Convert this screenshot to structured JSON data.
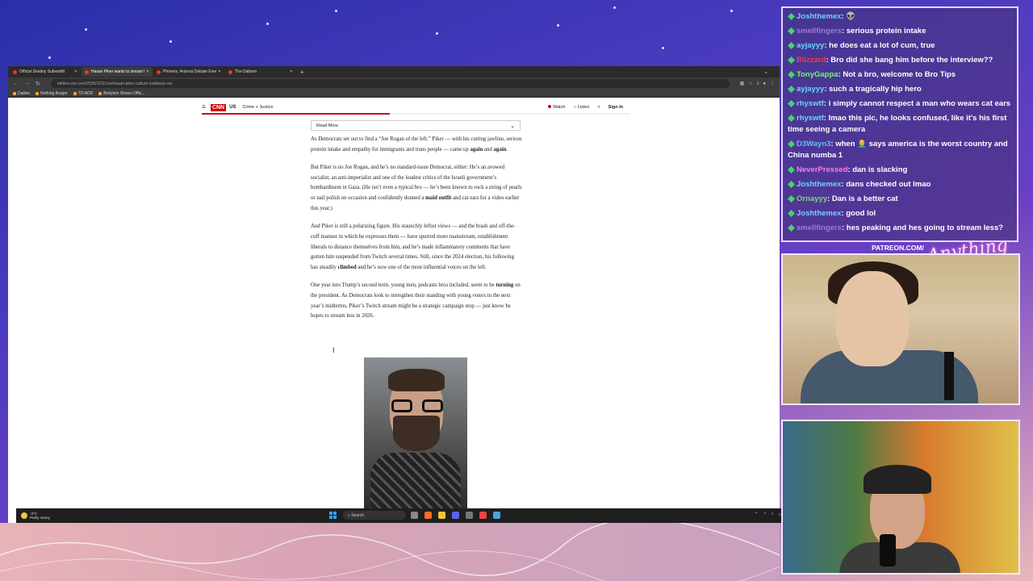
{
  "browser": {
    "tabs": [
      {
        "label": "Official Destiny Subreddit",
        "active": false
      },
      {
        "label": "Hasan Piker wants to stream le...",
        "active": true
      },
      {
        "label": "Phoenix, Arizona Debate Event",
        "active": false
      },
      {
        "label": "The Dablam",
        "active": false
      }
    ],
    "url": "edition.cnn.com/2025/12/21/us/hasan-piker-culture-lookback-cec",
    "bookmarks": [
      "Dailies",
      "Nothing Burger",
      "TO ADD",
      "Bodyism Shows Offic..."
    ]
  },
  "cnn": {
    "logo": "CNN",
    "edition": "US",
    "section": "Crime + Justice",
    "watch": "Watch",
    "listen": "Listen",
    "sign_in": "Sign In",
    "read_more": "Read More",
    "reading_progress": 0.44
  },
  "article": {
    "p1_a": "As Democrats set out to find a “Joe Rogan of the left,” Piker — with his cutting jawline, serious protein intake and empathy for immigrants and trans people — came up ",
    "p1_b1": "again",
    "p1_mid": " and ",
    "p1_b2": "again",
    "p1_end": ".",
    "p2_a": "But Piker is no Joe Rogan, and he’s no standard-issue Democrat, either: He’s an avowed socialist, an anti-imperialist and one of the loudest critics of the Israeli government’s bombardment in Gaza. (He isn’t even a typical bro — he’s been known to rock a string of pearls or nail polish on occasion and confidently donned a ",
    "p2_b": "maid outfit",
    "p2_end": " and cat ears for a video earlier this year.)",
    "p3_a": "And Piker is still a polarizing figure. His staunchly leftist views — and the brash and off-the-cuff manner in which he expresses them — have spurred more mainstream, establishment liberals to distance themselves from him, and he’s made inflammatory comments that have gotten him suspended from Twitch several times. Still, since the 2024 election, his following has steadily ",
    "p3_b": "climbed",
    "p3_end": " and he’s now one of the most influential voices on the left.",
    "p4_a": "One year into Trump’s second term, young men, podcasts bros included, seem to be ",
    "p4_b": "turning",
    "p4_end": " on the president. As Democrats look to strengthen their standing with young voters in the next year’s midterms, Piker’s Twitch stream might be a strategic campaign stop — just know he hopes to stream less in 2026."
  },
  "taskbar": {
    "temp": "-3°C",
    "weather": "Partly sunny",
    "search": "Search"
  },
  "chat": [
    {
      "user": "Joshthemex",
      "color": "#6fd1ff",
      "text": "👽"
    },
    {
      "user": "smellfingers",
      "color": "#9a7bd9",
      "text": "serious protein intake"
    },
    {
      "user": "ayjayyy",
      "color": "#66d9ff",
      "text": "he does eat a lot of cum, true"
    },
    {
      "user": "Blizzard",
      "color": "#ff3b3b",
      "text": "Bro did she bang him before the interview??"
    },
    {
      "user": "TonyGappa",
      "color": "#6bff6b",
      "text": "Not a bro, welcome to Bro Tips"
    },
    {
      "user": "ayjayyy",
      "color": "#66d9ff",
      "text": "such a tragically hip hero"
    },
    {
      "user": "rhyswtf",
      "color": "#6fd1ff",
      "text": "i simply cannot respect a man who wears cat ears"
    },
    {
      "user": "rhyswtf",
      "color": "#6fd1ff",
      "text": "lmao this pic, he looks confused, like it's his first time seeing a camera"
    },
    {
      "user": "D3Wayn3",
      "color": "#5ec0ff",
      "text": "when 👨‍🦲 says america is the worst country and China numba 1"
    },
    {
      "user": "NeverPressed",
      "color": "#ff7ee0",
      "text": "dan is slacking"
    },
    {
      "user": "Joshthemex",
      "color": "#6fd1ff",
      "text": "dans checked out lmao"
    },
    {
      "user": "Ornayyy",
      "color": "#7bd96b",
      "text": "Dan is a better cat"
    },
    {
      "user": "Joshthemex",
      "color": "#6fd1ff",
      "text": "good lol"
    },
    {
      "user": "smellfingers",
      "color": "#9a7bd9",
      "text": "hes peaking and hes going to stream less?"
    }
  ],
  "overlay": {
    "patreon": "PATREON.COM/",
    "sign": "Anything Goes"
  },
  "colors": {
    "cnn_red": "#cc0000",
    "chat_border": "#e8d3ff"
  }
}
